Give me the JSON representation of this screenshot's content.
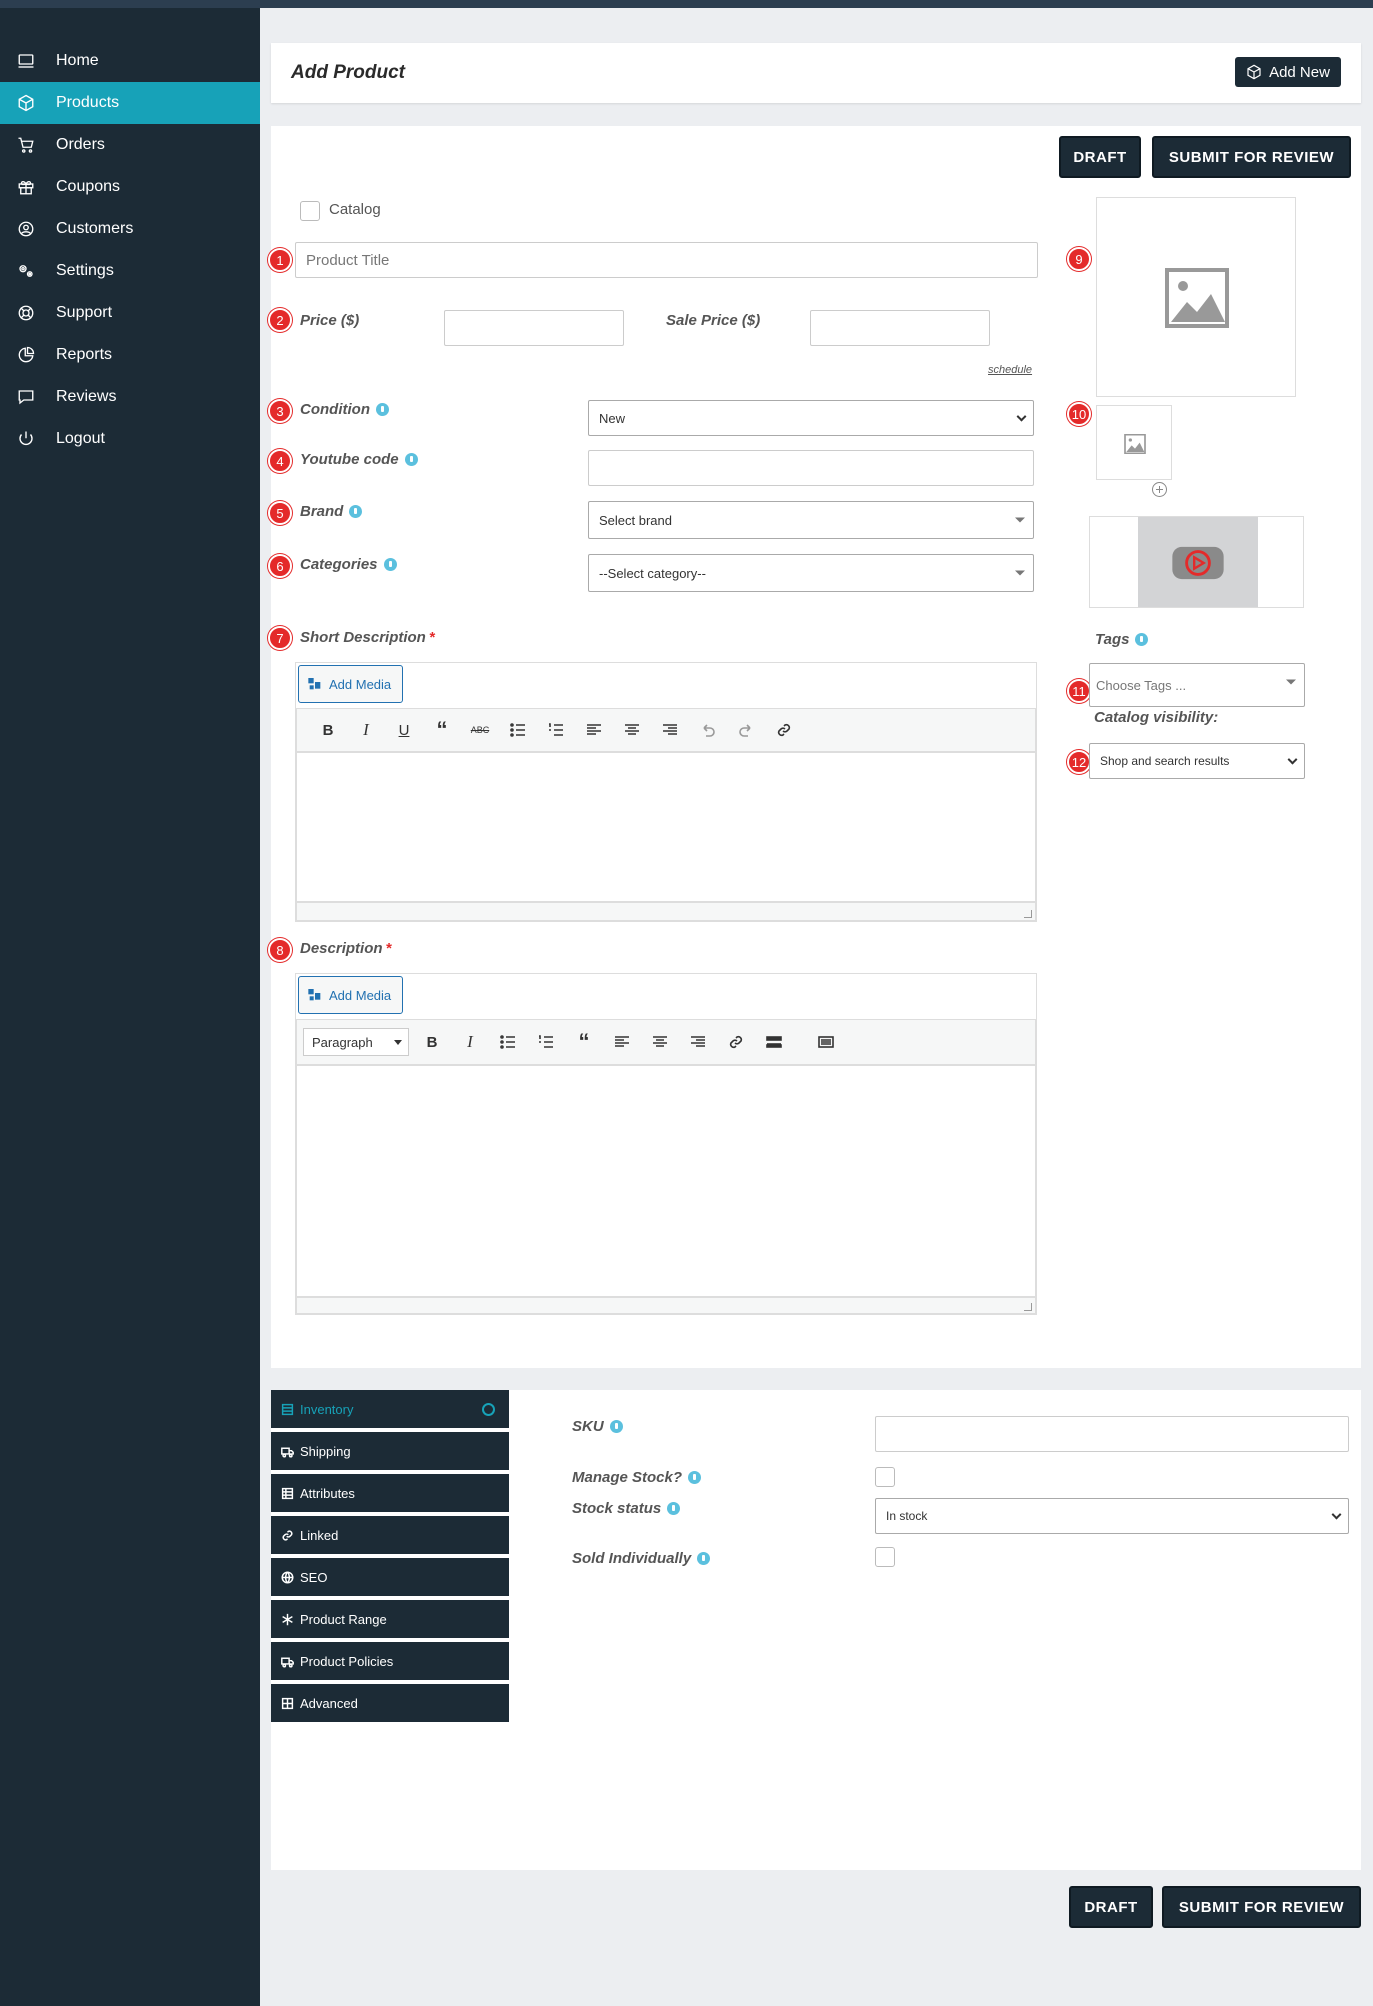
{
  "sidebar": {
    "items": [
      {
        "label": "Home",
        "icon": "monitor-icon"
      },
      {
        "label": "Products",
        "icon": "cube-icon"
      },
      {
        "label": "Orders",
        "icon": "cart-icon"
      },
      {
        "label": "Coupons",
        "icon": "gift-icon"
      },
      {
        "label": "Customers",
        "icon": "user-circle-icon"
      },
      {
        "label": "Settings",
        "icon": "cogs-icon"
      },
      {
        "label": "Support",
        "icon": "lifebuoy-icon"
      },
      {
        "label": "Reports",
        "icon": "pie-chart-icon"
      },
      {
        "label": "Reviews",
        "icon": "comment-icon"
      },
      {
        "label": "Logout",
        "icon": "power-icon"
      }
    ],
    "active": "Products"
  },
  "header": {
    "title": "Add Product",
    "add_new": "Add New"
  },
  "actions": {
    "draft": "DRAFT",
    "submit": "SUBMIT FOR REVIEW"
  },
  "form": {
    "catalog_label": "Catalog",
    "product_title_placeholder": "Product Title",
    "price_label": "Price ($)",
    "sale_price_label": "Sale Price ($)",
    "schedule": "schedule",
    "condition_label": "Condition",
    "condition_value": "New",
    "youtube_label": "Youtube code",
    "brand_label": "Brand",
    "brand_value": "Select brand",
    "categories_label": "Categories",
    "categories_value": "--Select category--",
    "short_desc_label": "Short Description",
    "desc_label": "Description",
    "required_mark": "*",
    "add_media": "Add Media",
    "paragraph": "Paragraph"
  },
  "markers": [
    "1",
    "2",
    "3",
    "4",
    "5",
    "6",
    "7",
    "8",
    "9",
    "10",
    "11",
    "12"
  ],
  "side": {
    "tags_label": "Tags",
    "tags_placeholder": "Choose Tags ...",
    "catalog_visibility_label": "Catalog visibility:",
    "catalog_visibility_value": "Shop and search results"
  },
  "tabs": [
    {
      "label": "Inventory",
      "icon": "box-icon"
    },
    {
      "label": "Shipping",
      "icon": "truck-icon"
    },
    {
      "label": "Attributes",
      "icon": "list-icon"
    },
    {
      "label": "Linked",
      "icon": "link-icon"
    },
    {
      "label": "SEO",
      "icon": "globe-icon"
    },
    {
      "label": "Product Range",
      "icon": "snowflake-icon"
    },
    {
      "label": "Product Policies",
      "icon": "truck-loading-icon"
    },
    {
      "label": "Advanced",
      "icon": "grid-icon"
    }
  ],
  "inventory": {
    "sku_label": "SKU",
    "manage_stock_label": "Manage Stock?",
    "stock_status_label": "Stock status",
    "stock_status_value": "In stock",
    "sold_individually_label": "Sold Individually"
  }
}
